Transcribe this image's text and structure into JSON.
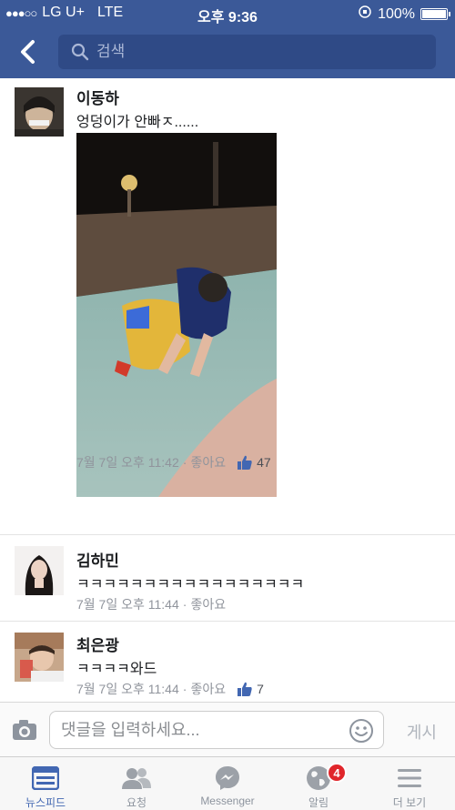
{
  "status_bar": {
    "carrier": "LG U+",
    "network": "LTE",
    "time": "오후 9:36",
    "battery": "100%"
  },
  "nav": {
    "search_placeholder": "검색"
  },
  "comments": [
    {
      "name": "이동하",
      "text": "엉덩이가 안빠ㅈ......",
      "time": "7월 7일 오후 11:42",
      "like_label": "좋아요",
      "like_count": "47"
    },
    {
      "name": "김하민",
      "text": "ㅋㅋㅋㅋㅋㅋㅋㅋㅋㅋㅋㅋㅋㅋㅋㅋㅋ",
      "time": "7월 7일 오후 11:44",
      "like_label": "좋아요"
    },
    {
      "name": "최은광",
      "text": "ㅋㅋㅋㅋ와드",
      "time": "7월 7일 오후 11:44",
      "like_label": "좋아요",
      "like_count": "7"
    }
  ],
  "composer": {
    "placeholder": "댓글을 입력하세요...",
    "post_label": "게시"
  },
  "tabs": [
    {
      "label": "뉴스피드",
      "icon": "newsfeed-icon"
    },
    {
      "label": "요청",
      "icon": "friend-requests-icon"
    },
    {
      "label": "Messenger",
      "icon": "messenger-icon"
    },
    {
      "label": "알림",
      "icon": "globe-icon",
      "badge": "4"
    },
    {
      "label": "더 보기",
      "icon": "menu-icon"
    }
  ],
  "colors": {
    "brand": "#3b5998",
    "active_tab": "#4267b2",
    "badge": "#e0262b"
  }
}
